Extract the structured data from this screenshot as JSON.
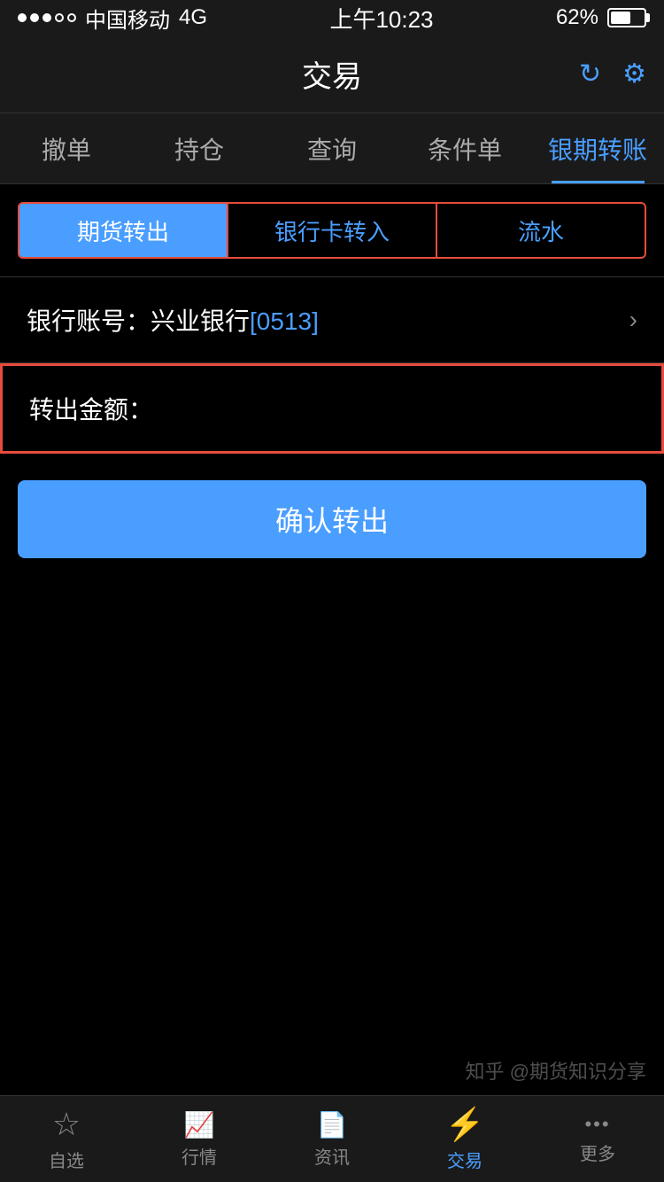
{
  "statusBar": {
    "carrier": "中国移动",
    "network": "4G",
    "time": "上午10:23",
    "battery": "62%"
  },
  "header": {
    "title": "交易",
    "refreshIcon": "↻",
    "settingsIcon": "⚙"
  },
  "navTabs": [
    {
      "id": "cancel",
      "label": "撤单",
      "active": false
    },
    {
      "id": "position",
      "label": "持仓",
      "active": false
    },
    {
      "id": "query",
      "label": "查询",
      "active": false
    },
    {
      "id": "condition",
      "label": "条件单",
      "active": false
    },
    {
      "id": "transfer",
      "label": "银期转账",
      "active": true
    }
  ],
  "subTabs": [
    {
      "id": "futures-out",
      "label": "期货转出",
      "active": true
    },
    {
      "id": "bank-in",
      "label": "银行卡转入",
      "active": false
    },
    {
      "id": "flow",
      "label": "流水",
      "active": false
    }
  ],
  "bankAccount": {
    "label": "银行账号：兴业银行",
    "bankName": "兴业银行",
    "accountId": "[0513]"
  },
  "amountField": {
    "label": "转出金额：",
    "placeholder": ""
  },
  "confirmButton": {
    "label": "确认转出"
  },
  "bottomNav": [
    {
      "id": "watchlist",
      "label": "自选",
      "icon": "star",
      "active": false
    },
    {
      "id": "market",
      "label": "行情",
      "icon": "chart",
      "active": false
    },
    {
      "id": "news",
      "label": "资讯",
      "icon": "doc",
      "active": false
    },
    {
      "id": "trade",
      "label": "交易",
      "icon": "lightning",
      "active": true
    },
    {
      "id": "more",
      "label": "更多",
      "icon": "more",
      "active": false
    }
  ],
  "watermark": "知乎 @期货知识分享"
}
